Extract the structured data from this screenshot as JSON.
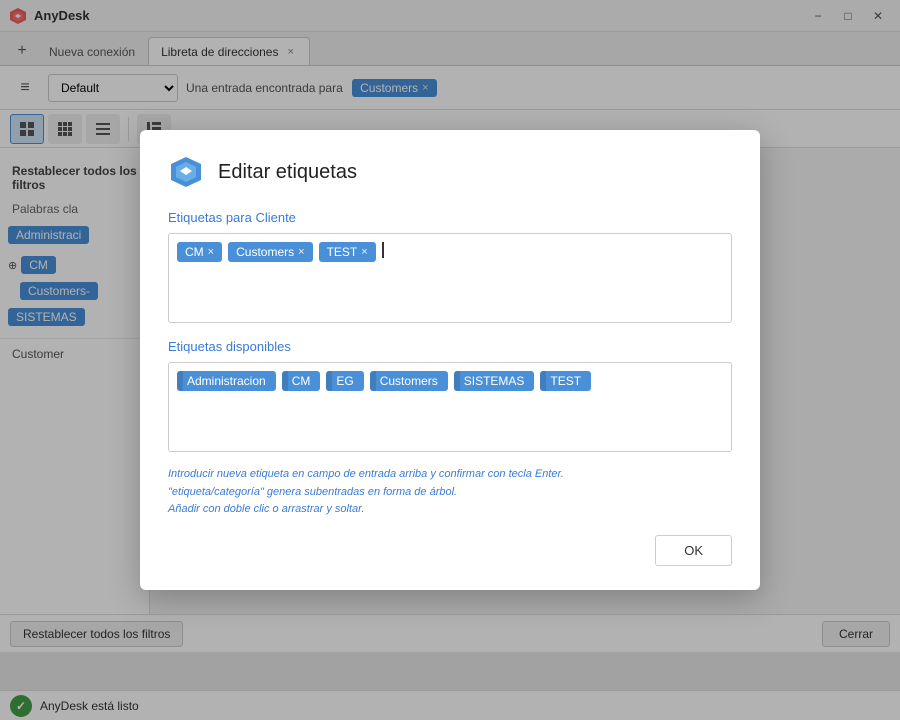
{
  "titlebar": {
    "app_name": "AnyDesk",
    "minimize_label": "−",
    "maximize_label": "□",
    "close_label": "✕"
  },
  "tabs": {
    "new_tab_label": "+",
    "new_connection_label": "Nueva conexión",
    "address_book_label": "Libreta de direcciones",
    "address_book_close": "×"
  },
  "toolbar": {
    "menu_icon": "≡",
    "dropdown_value": "Default",
    "search_prefix": "Una entrada encontrada para",
    "search_tag": "Customers",
    "search_tag_close": "×"
  },
  "icon_toolbar": {
    "icon1": "⊡",
    "icon2": "⊞",
    "icon3": "⊟",
    "icon4": "☰"
  },
  "sidebar": {
    "filters_label": "Filtros",
    "keywords_label": "Palabras cla",
    "tags": [
      {
        "label": "Administraci",
        "color": "blue"
      },
      {
        "label": "CM",
        "color": "blue",
        "expanded": true
      },
      {
        "label": "Customers-",
        "color": "blue"
      },
      {
        "label": "SISTEMAS",
        "color": "blue"
      }
    ],
    "customer_label": "Customer"
  },
  "modal": {
    "title": "Editar etiquetas",
    "logo_text": "AD",
    "section1_label": "Etiquetas para Cliente",
    "current_tags": [
      {
        "label": "CM",
        "closable": true
      },
      {
        "label": "Customers",
        "closable": true
      },
      {
        "label": "TEST",
        "closable": true
      }
    ],
    "section2_label": "Etiquetas disponibles",
    "available_tags": [
      {
        "label": "Administracion"
      },
      {
        "label": "CM"
      },
      {
        "label": "EG"
      },
      {
        "label": "Customers"
      },
      {
        "label": "SISTEMAS"
      },
      {
        "label": "TEST"
      }
    ],
    "hint_line1": "Introducir nueva etiqueta en campo de entrada arriba y confirmar con tecla Enter.",
    "hint_line2": "\"etiqueta/categoría\" genera subentradas en forma de árbol.",
    "hint_line3": "Añadir con doble clic o arrastrar y soltar.",
    "ok_label": "OK"
  },
  "bottom": {
    "reset_filters_label": "Restablecer todos los filtros",
    "close_label": "Cerrar",
    "status_icon": "✓",
    "status_text": "AnyDesk está listo"
  }
}
